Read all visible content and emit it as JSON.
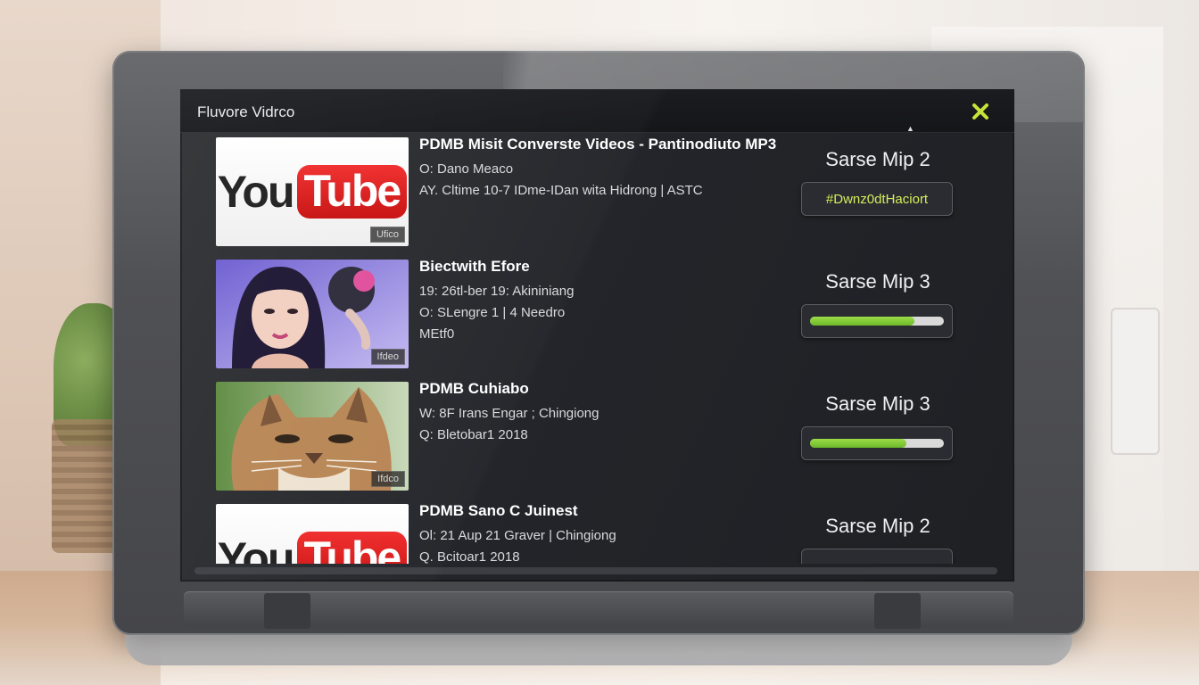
{
  "app": {
    "title": "Fluvore Vidrco",
    "close_icon": "close-icon",
    "accent": "#c6e33a",
    "progress_color": "#7cc52f"
  },
  "videos": [
    {
      "title": "PDMB Misit Converste Videos - Pantinodiuto MP3",
      "meta": [
        "O: Dano Meaco",
        "AY. Cltime 10-7 IDme-IDan wita Hidrong | ASTC"
      ],
      "thumbnail": "youtube-logo",
      "thumb_badge": "Ufico",
      "status": "Sarse Mip 2",
      "action": {
        "type": "button",
        "label": "#Dwnz0dtHaciort"
      }
    },
    {
      "title": "Biectwith Efore",
      "meta": [
        "19: 26tl-ber 19: Akininiang",
        "O: SLengre 1 | 4 Needro",
        "MEtf0"
      ],
      "thumbnail": "portrait-photo",
      "thumb_badge": "Ifdeo",
      "status": "Sarse Mip 3",
      "action": {
        "type": "progress",
        "progress": 0.78
      }
    },
    {
      "title": "PDMB Cuhiabo",
      "meta": [
        "W: 8F Irans Engar ; Chingiong",
        "Q: Bletobar1 2018"
      ],
      "thumbnail": "cat-photo",
      "thumb_badge": "Ifdco",
      "status": "Sarse Mip 3",
      "action": {
        "type": "progress",
        "progress": 0.72
      }
    },
    {
      "title": "PDMB Sano C Juinest",
      "meta": [
        "Ol: 21 Aup 21 Graver | Chingiong",
        "Q. Bcitoar1 2018"
      ],
      "thumbnail": "youtube-logo",
      "thumb_badge": "",
      "status": "Sarse Mip 2",
      "action": {
        "type": "button",
        "label": ""
      }
    }
  ],
  "logo": {
    "you": "You",
    "tube": "Tube"
  }
}
